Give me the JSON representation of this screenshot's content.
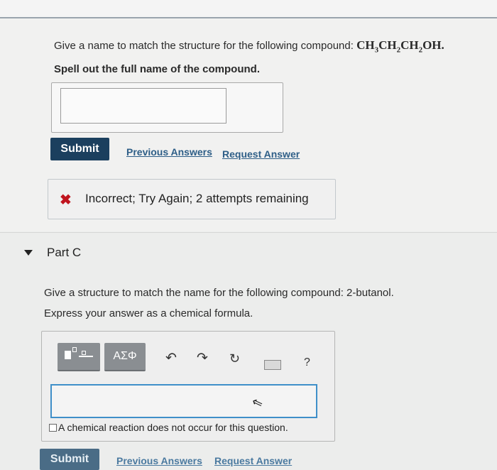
{
  "part_b": {
    "question_prefix": "Give a name to match the structure for the following compound: ",
    "formula_parts": [
      "CH",
      "3",
      "CH",
      "2",
      "CH",
      "2",
      "OH"
    ],
    "formula_end": ".",
    "instruction": "Spell out the full name of the compound.",
    "answer_value": "",
    "submit_label": "Submit",
    "previous_answers_label": "Previous Answers",
    "request_answer_label": "Request Answer",
    "feedback_icon": "x-icon",
    "feedback_text": "Incorrect; Try Again; 2 attempts remaining"
  },
  "part_c": {
    "title": "Part C",
    "question": "Give a structure to match the name for the following compound: 2-butanol.",
    "instruction": "Express your answer as a chemical formula.",
    "toolbar": {
      "greek_label": "ΑΣΦ",
      "icons": [
        "templates-icon",
        "greek-letters-icon",
        "undo-icon",
        "redo-icon",
        "reset-icon",
        "keyboard-icon",
        "help-icon"
      ],
      "help_label": "?"
    },
    "answer_value": "",
    "checkbox_label": "A chemical reaction does not occur for this question.",
    "checkbox_checked": false,
    "submit_label": "Submit",
    "previous_answers_label": "Previous Answers",
    "request_answer_label": "Request Answer"
  },
  "colors": {
    "submit_bg": "#1b3f5e",
    "link": "#2e5e87",
    "error_x": "#c0141e",
    "input_focus": "#3f8fc9"
  }
}
